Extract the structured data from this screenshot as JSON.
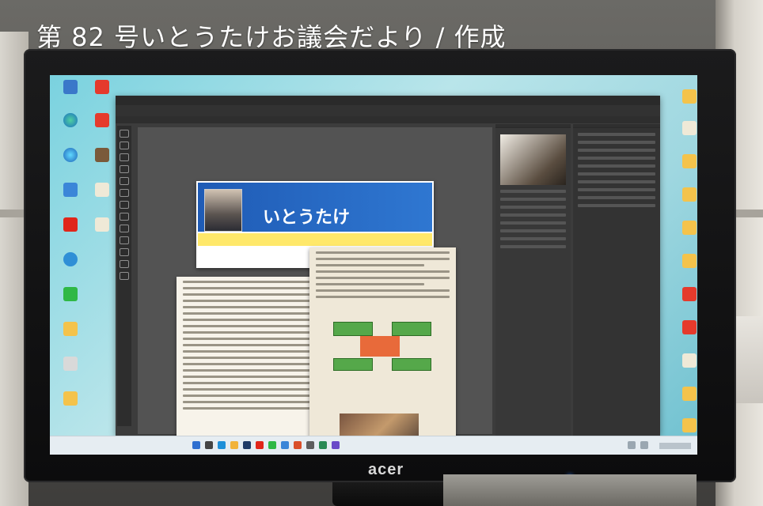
{
  "caption": "第 82 号いとうたけお議会だより / 作成",
  "monitor": {
    "brand": "acer"
  },
  "document": {
    "front_name": "いとうたけ"
  },
  "colors": {
    "screen_bg": "#9fd7e0",
    "photoshop_bg": "#3c3c3c",
    "newsletter_blue": "#1f5bb5",
    "newsletter_red": "#d4241b",
    "newsletter_yellow": "#ffe86a",
    "accent_green": "#55a84a"
  }
}
